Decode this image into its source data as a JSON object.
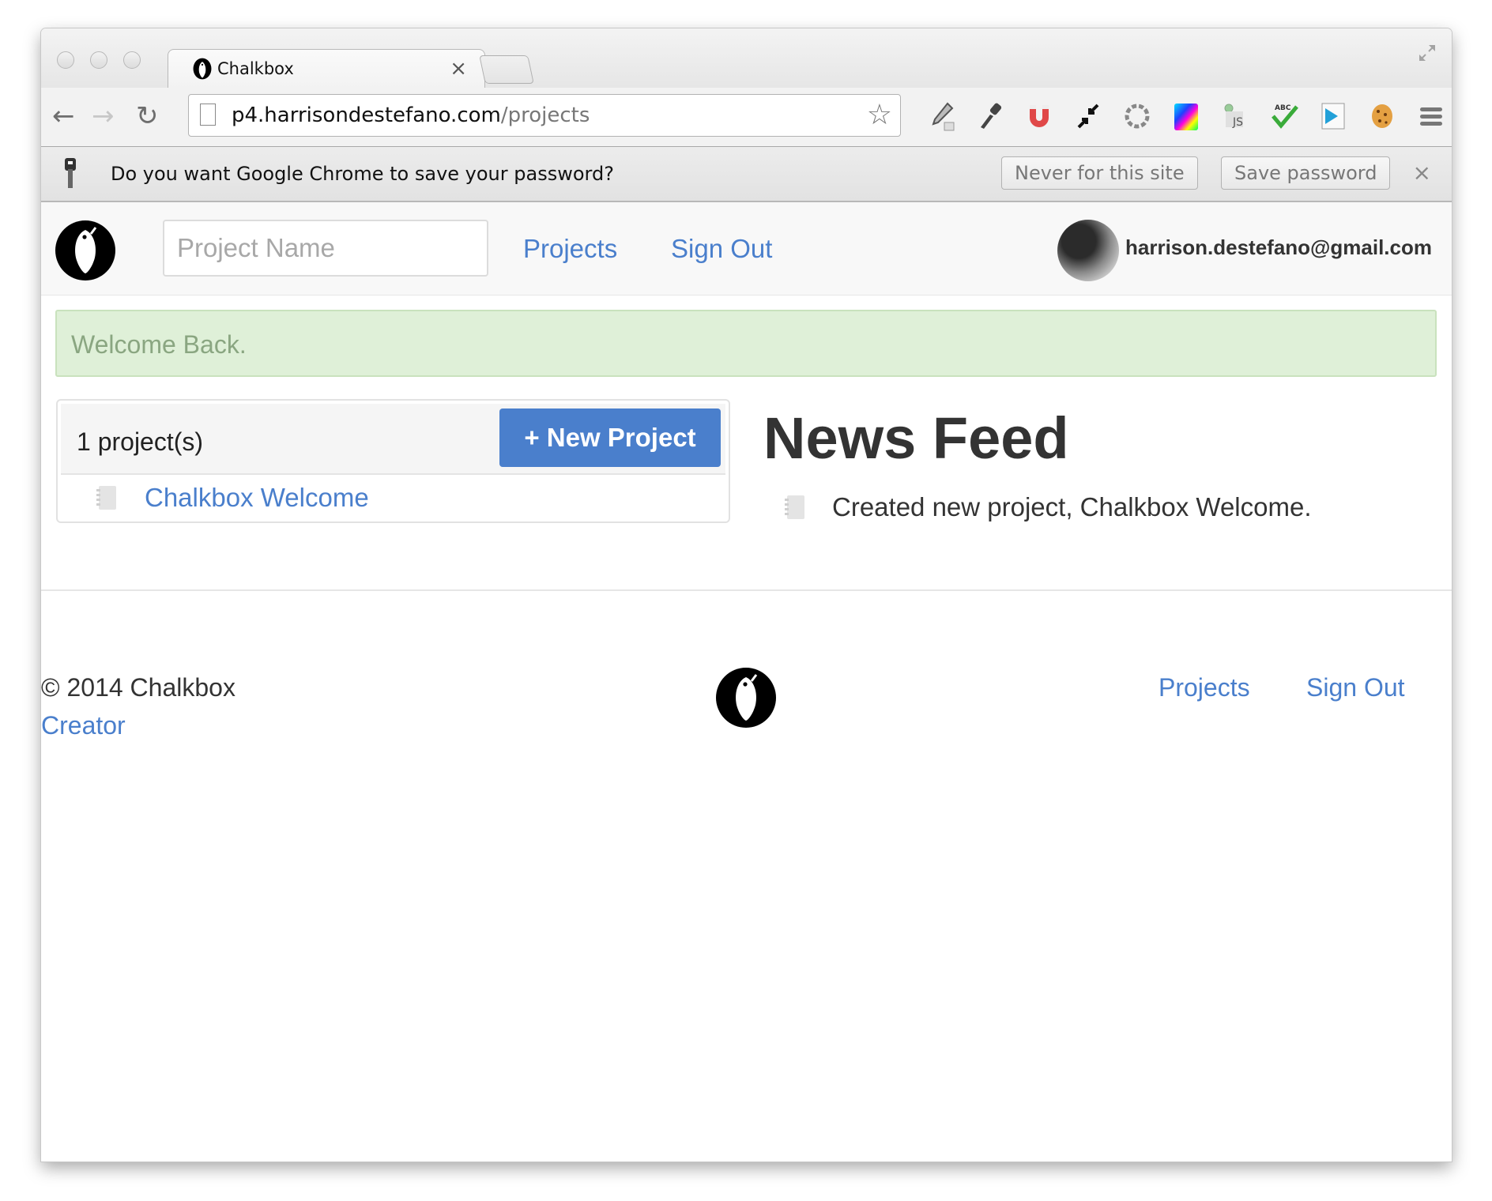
{
  "browser": {
    "tab_title": "Chalkbox",
    "tab_close": "×",
    "url_host": "p4.harrisondestefano.com",
    "url_path": "/projects",
    "nav": {
      "back": "←",
      "forward": "→",
      "reload": "↻"
    },
    "star": "☆",
    "extensions": [
      {
        "name": "eyedropper-icon",
        "glyph": "🖉"
      },
      {
        "name": "key-icon",
        "glyph": "🔑"
      },
      {
        "name": "magnet-icon",
        "glyph": "U"
      },
      {
        "name": "collapse-arrows-icon",
        "glyph": "⤡"
      },
      {
        "name": "aperture-icon",
        "glyph": "◎"
      },
      {
        "name": "color-gradient-icon",
        "glyph": "■"
      },
      {
        "name": "js-icon",
        "glyph": "JS"
      },
      {
        "name": "spellcheck-icon",
        "glyph": "✔"
      },
      {
        "name": "play-document-icon",
        "glyph": "▶"
      },
      {
        "name": "cookie-icon",
        "glyph": "●"
      },
      {
        "name": "menu-icon",
        "glyph": "≡"
      }
    ]
  },
  "infobar": {
    "message": "Do you want Google Chrome to save your password?",
    "never_label": "Never for this site",
    "save_label": "Save password",
    "close": "×"
  },
  "header": {
    "search_placeholder": "Project Name",
    "search_value": "",
    "nav": [
      {
        "label": "Projects"
      },
      {
        "label": "Sign Out"
      }
    ],
    "user_email": "harrison.destefano@gmail.com"
  },
  "alert": {
    "message": "Welcome Back."
  },
  "projects": {
    "count_label": "1 project(s)",
    "new_button": "+ New Project",
    "items": [
      {
        "name": "Chalkbox Welcome"
      }
    ]
  },
  "feed": {
    "title": "News Feed",
    "items": [
      {
        "text": "Created new project, Chalkbox Welcome."
      }
    ]
  },
  "footer": {
    "copyright": "© 2014 Chalkbox",
    "creator": "Creator",
    "links": [
      {
        "label": "Projects"
      },
      {
        "label": "Sign Out"
      }
    ]
  },
  "colors": {
    "link": "#4a7fcc",
    "primary_button": "#4a7fcc",
    "alert_bg": "#dff0d8",
    "alert_text": "#8aa681"
  }
}
